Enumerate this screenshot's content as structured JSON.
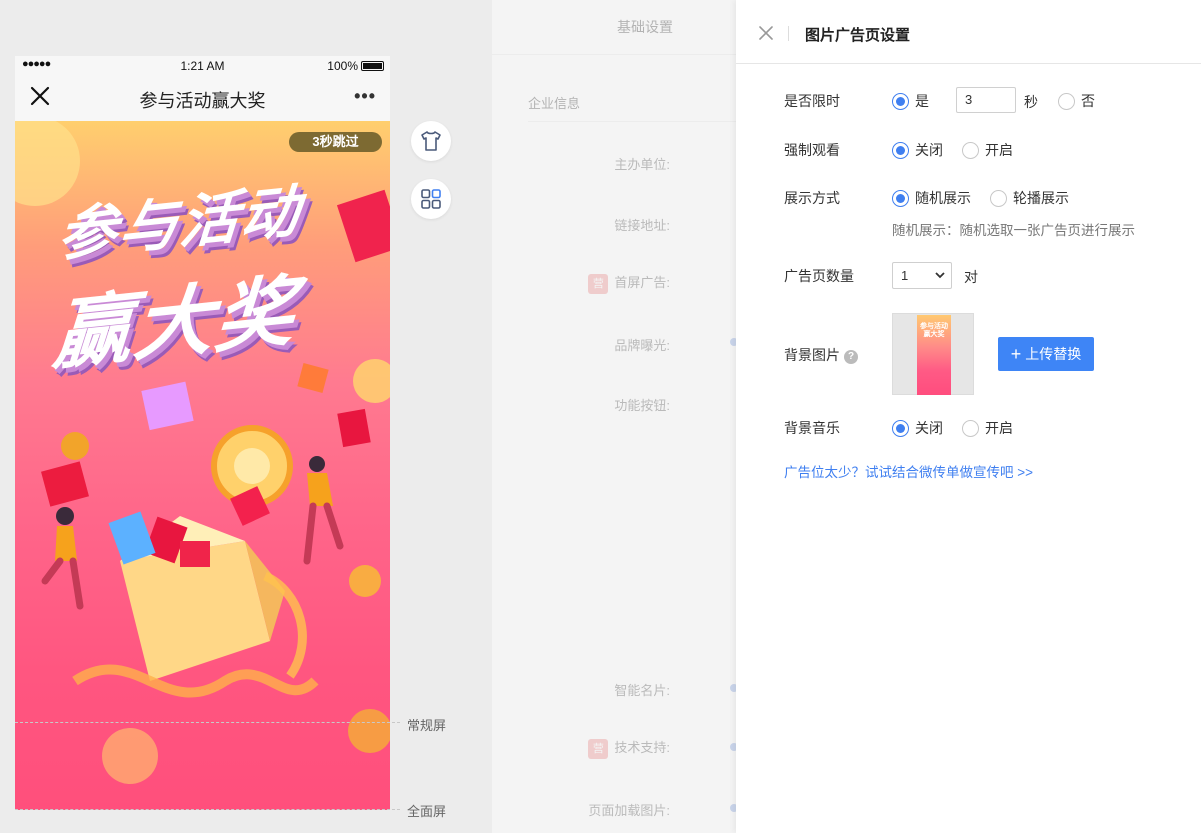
{
  "phone": {
    "status": {
      "signal": "●●●●●",
      "time": "1:21 AM",
      "battery": "100%"
    },
    "nav": {
      "title": "参与活动赢大奖",
      "more": "•••"
    },
    "poster": {
      "skip": "3秒跳过",
      "headline_line1": "参与活动",
      "headline_line2": "赢大奖"
    }
  },
  "guides": {
    "normal_screen": "常规屏",
    "full_screen": "全面屏"
  },
  "tools": [
    "shirt-icon",
    "grid-icon"
  ],
  "middle_form": {
    "tab": "基础设置",
    "section": "企业信息",
    "rows": [
      "主办单位:",
      "链接地址:",
      "首屏广告:",
      "品牌曝光:",
      "功能按钮:",
      "智能名片:",
      "技术支持:",
      "页面加载图片:"
    ],
    "badge": "营"
  },
  "panel": {
    "title": "图片广告页设置",
    "time_limit": {
      "label": "是否限时",
      "yes": "是",
      "seconds_value": "3",
      "unit": "秒",
      "no": "否"
    },
    "force_view": {
      "label": "强制观看",
      "off": "关闭",
      "on": "开启"
    },
    "display_mode": {
      "label": "展示方式",
      "random": "随机展示",
      "carousel": "轮播展示",
      "hint": "随机展示：随机选取一张广告页进行展示"
    },
    "ad_count": {
      "label": "广告页数量",
      "selected": "1",
      "unit": "对"
    },
    "background_image": {
      "label": "背景图片",
      "help": "?",
      "upload": "上传替换",
      "thumb_text": "参与活动\n赢大奖"
    },
    "background_music": {
      "label": "背景音乐",
      "off": "关闭",
      "on": "开启"
    },
    "promo_link": "广告位太少？试试结合微传单做宣传吧 >>",
    "accent_color": "#3f7ff0"
  }
}
